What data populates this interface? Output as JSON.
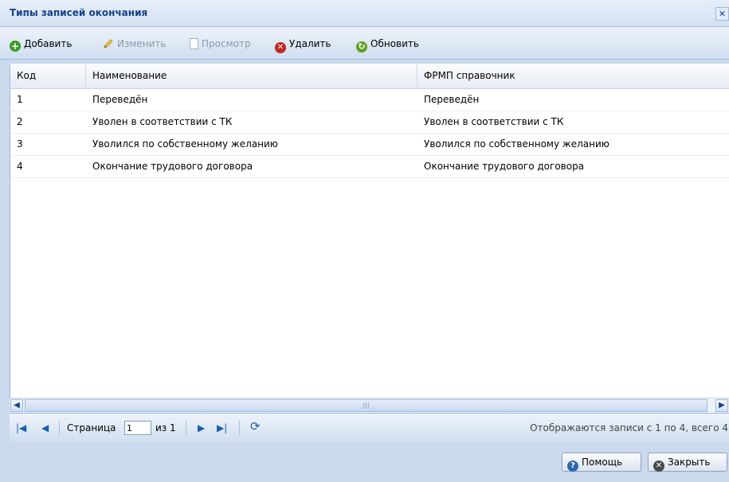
{
  "window": {
    "title": "Типы записей окончания",
    "close_glyph": "✕"
  },
  "toolbar": {
    "add": {
      "label": "Добавить",
      "icon": "plus-circle-icon",
      "enabled": true
    },
    "edit": {
      "label": "Изменить",
      "icon": "pencil-icon",
      "enabled": false
    },
    "view": {
      "label": "Просмотр",
      "icon": "document-icon",
      "enabled": false
    },
    "delete": {
      "label": "Удалить",
      "icon": "delete-circle-icon",
      "enabled": true
    },
    "refresh": {
      "label": "Обновить",
      "icon": "refresh-circle-icon",
      "enabled": true
    }
  },
  "grid": {
    "columns": [
      "Код",
      "Наименование",
      "ФРМП справочник"
    ],
    "rows": [
      [
        "1",
        "Переведён",
        "Переведён"
      ],
      [
        "2",
        "Уволен в соответствии с ТК",
        "Уволен в соответствии с ТК"
      ],
      [
        "3",
        "Уволился по собственному желанию",
        "Уволился по собственному желанию"
      ],
      [
        "4",
        "Окончание трудового договора",
        "Окончание трудового договора"
      ]
    ]
  },
  "pager": {
    "page_label": "Страница",
    "page_value": "1",
    "of_label": "из 1",
    "status": "Отображаются записи с 1 по 4, всего 4"
  },
  "footer": {
    "help_label": "Помощь",
    "close_label": "Закрыть"
  },
  "colors": {
    "title_text": "#15428b",
    "border": "#99bbe8",
    "panel_bg": "#cad9ec"
  }
}
